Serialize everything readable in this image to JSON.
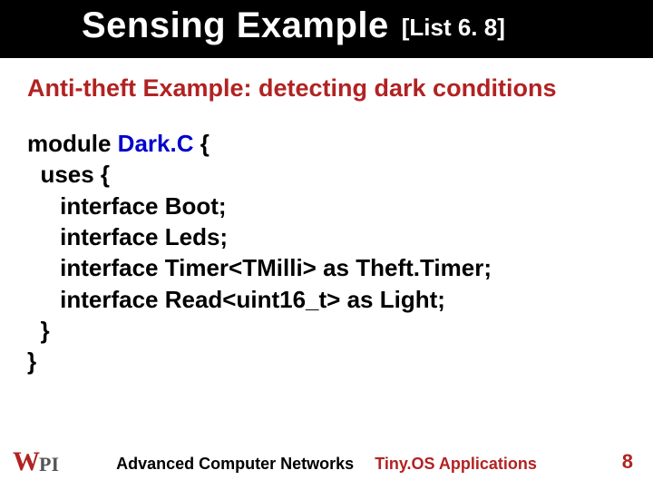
{
  "title": {
    "main": "Sensing Example",
    "sub": "[List 6. 8]"
  },
  "subtitle": "Anti-theft Example: detecting dark conditions",
  "code": {
    "l1a": "module ",
    "l1b": "Dark.C",
    "l1c": " {",
    "l2": "  uses {",
    "l3": "     interface Boot;",
    "l4": "     interface Leds;",
    "l5": "     interface Timer<TMilli> as Theft.Timer;",
    "l6": "     interface Read<uint16_t> as Light;",
    "l7": "  }",
    "l8": "}"
  },
  "footer": {
    "logoW": "W",
    "logoPI": "PI",
    "center_left": "Advanced Computer Networks",
    "center_right": "Tiny.OS Applications",
    "page": "8"
  }
}
